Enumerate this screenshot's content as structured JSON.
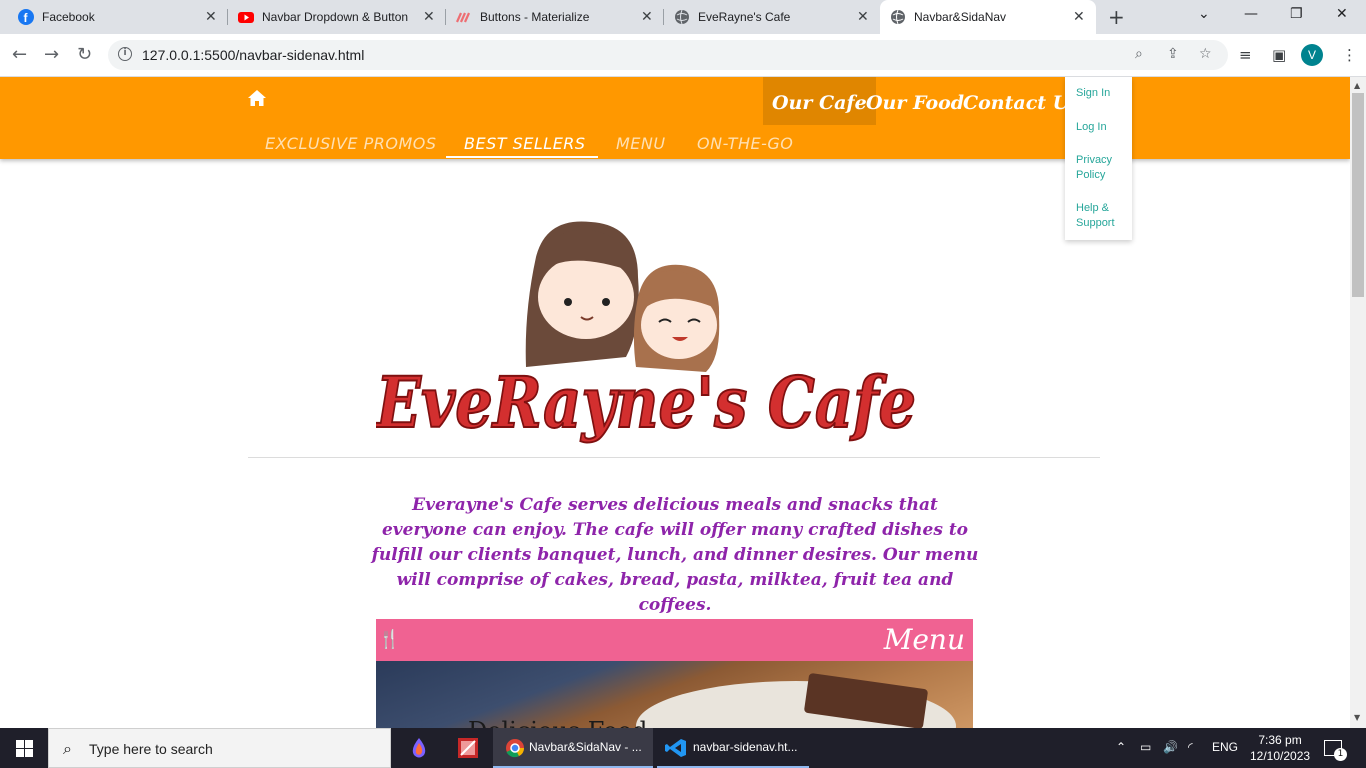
{
  "browser": {
    "tabs": [
      {
        "title": "Facebook"
      },
      {
        "title": "Navbar Dropdown & Button"
      },
      {
        "title": "Buttons - Materialize"
      },
      {
        "title": "EveRayne's Cafe"
      },
      {
        "title": "Navbar&SidaNav"
      }
    ],
    "url": "127.0.0.1:5500/navbar-sidenav.html",
    "profile_initial": "V"
  },
  "navbar": {
    "main_links": [
      "Our Cafe",
      "Our Food",
      "Contact Us"
    ],
    "sub_links": [
      "EXCLUSIVE PROMOS",
      "BEST SELLERS",
      "MENU",
      "ON-THE-GO"
    ],
    "dropdown": [
      "Sign In",
      "Log In",
      "Privacy Policy",
      "Help & Support"
    ],
    "color": "#ff9800"
  },
  "logo": {
    "text": "EveRayne's Cafe"
  },
  "description": "Everayne's Cafe serves delicious meals and snacks that everyone can enjoy. The cafe will offer many crafted dishes to fulfill our clients banquet, lunch, and dinner desires. Our menu will comprise of cakes, bread, pasta, milktea, fruit tea and coffees.",
  "menu_card": {
    "title": "Menu",
    "photo_text": "Delicious Food",
    "color": "#f06292"
  },
  "taskbar": {
    "search_placeholder": "Type here to search",
    "apps": [
      "Navbar&SidaNav - ...",
      "navbar-sidenav.ht..."
    ],
    "language": "ENG",
    "time": "7:36 pm",
    "date": "12/10/2023",
    "notifications": "1"
  }
}
